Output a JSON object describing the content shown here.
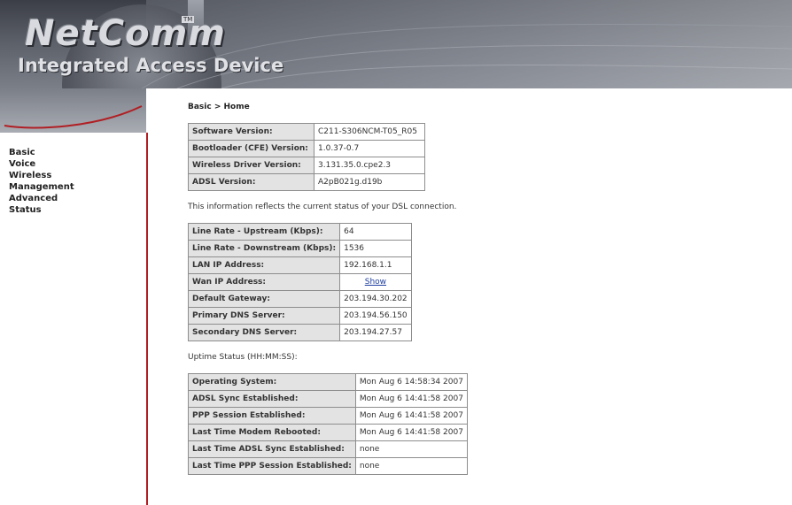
{
  "header": {
    "brand": "NetComm",
    "trademark": "TM",
    "subtitle": "Integrated Access Device"
  },
  "sidebar": {
    "items": [
      {
        "label": "Basic"
      },
      {
        "label": "Voice"
      },
      {
        "label": "Wireless"
      },
      {
        "label": "Management"
      },
      {
        "label": "Advanced"
      },
      {
        "label": "Status"
      }
    ]
  },
  "breadcrumb": "Basic > Home",
  "version_table": [
    {
      "label": "Software Version:",
      "value": "C211-S306NCM-T05_R05"
    },
    {
      "label": "Bootloader (CFE) Version:",
      "value": "1.0.37-0.7"
    },
    {
      "label": "Wireless Driver Version:",
      "value": "3.131.35.0.cpe2.3"
    },
    {
      "label": "ADSL Version:",
      "value": "A2pB021g.d19b"
    }
  ],
  "dsl_info": "This information reflects the current status of your DSL connection.",
  "dsl_table": [
    {
      "label": "Line Rate - Upstream (Kbps):",
      "value": "64"
    },
    {
      "label": "Line Rate - Downstream (Kbps):",
      "value": "1536"
    },
    {
      "label": "LAN IP Address:",
      "value": "192.168.1.1"
    },
    {
      "label": "Wan IP Address:",
      "value": "Show"
    },
    {
      "label": "Default Gateway:",
      "value": "203.194.30.202"
    },
    {
      "label": "Primary DNS Server:",
      "value": "203.194.56.150"
    },
    {
      "label": "Secondary DNS Server:",
      "value": "203.194.27.57"
    }
  ],
  "uptime_label": "Uptime Status (HH:MM:SS):",
  "uptime_table": [
    {
      "label": "Operating System:",
      "value": "Mon Aug 6 14:58:34 2007"
    },
    {
      "label": "ADSL Sync Established:",
      "value": "Mon Aug 6 14:41:58 2007"
    },
    {
      "label": "PPP Session Established:",
      "value": "Mon Aug 6 14:41:58 2007"
    },
    {
      "label": "Last Time Modem Rebooted:",
      "value": "Mon Aug 6 14:41:58 2007"
    },
    {
      "label": "Last Time ADSL Sync Established:",
      "value": "none"
    },
    {
      "label": "Last Time PPP Session Established:",
      "value": "none"
    }
  ]
}
